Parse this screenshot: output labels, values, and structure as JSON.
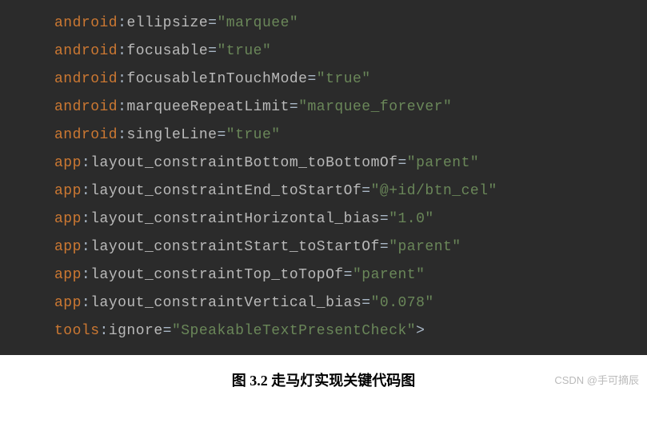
{
  "code": {
    "lines": [
      {
        "ns": "android",
        "attr": "ellipsize",
        "val": "\"marquee\"",
        "end": ""
      },
      {
        "ns": "android",
        "attr": "focusable",
        "val": "\"true\"",
        "end": ""
      },
      {
        "ns": "android",
        "attr": "focusableInTouchMode",
        "val": "\"true\"",
        "end": ""
      },
      {
        "ns": "android",
        "attr": "marqueeRepeatLimit",
        "val": "\"marquee_forever\"",
        "end": ""
      },
      {
        "ns": "android",
        "attr": "singleLine",
        "val": "\"true\"",
        "end": ""
      },
      {
        "ns": "app",
        "attr": "layout_constraintBottom_toBottomOf",
        "val": "\"parent\"",
        "end": ""
      },
      {
        "ns": "app",
        "attr": "layout_constraintEnd_toStartOf",
        "val": "\"@+id/btn_cel\"",
        "end": ""
      },
      {
        "ns": "app",
        "attr": "layout_constraintHorizontal_bias",
        "val": "\"1.0\"",
        "end": ""
      },
      {
        "ns": "app",
        "attr": "layout_constraintStart_toStartOf",
        "val": "\"parent\"",
        "end": ""
      },
      {
        "ns": "app",
        "attr": "layout_constraintTop_toTopOf",
        "val": "\"parent\"",
        "end": ""
      },
      {
        "ns": "app",
        "attr": "layout_constraintVertical_bias",
        "val": "\"0.078\"",
        "end": ""
      },
      {
        "ns": "tools",
        "attr": "ignore",
        "val": "\"SpeakableTextPresentCheck\"",
        "end": ">"
      }
    ]
  },
  "caption": {
    "text": "图 3.2  走马灯实现关键代码图"
  },
  "watermark": {
    "text": "CSDN @手可摘辰"
  }
}
